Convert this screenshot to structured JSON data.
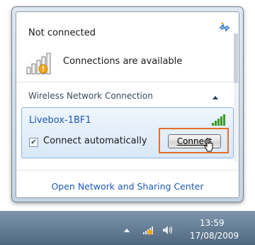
{
  "flyout": {
    "status_title": "Not connected",
    "availability_text": "Connections are available",
    "section_title": "Wireless Network Connection",
    "network": {
      "name": "Livebox-1BF1",
      "connect_automatically_label": "Connect automatically",
      "connect_automatically_checked": true,
      "connect_button_label": "Connect"
    },
    "open_center_link": "Open Network and Sharing Center"
  },
  "taskbar": {
    "time": "13:59",
    "date": "17/08/2009"
  },
  "colors": {
    "link": "#1c59b0",
    "signal_green": "#3a9a24",
    "highlight_orange": "#e46f2c",
    "taskbar": "#5d748c"
  },
  "icons": {
    "refresh": "refresh-icon",
    "signal_available": "signal-bars-available-icon",
    "collapse": "chevron-up-icon",
    "network_signal": "signal-bars-icon",
    "tray_network": "network-tray-icon",
    "tray_volume": "speaker-icon",
    "cursor": "mouse-pointer-icon"
  }
}
